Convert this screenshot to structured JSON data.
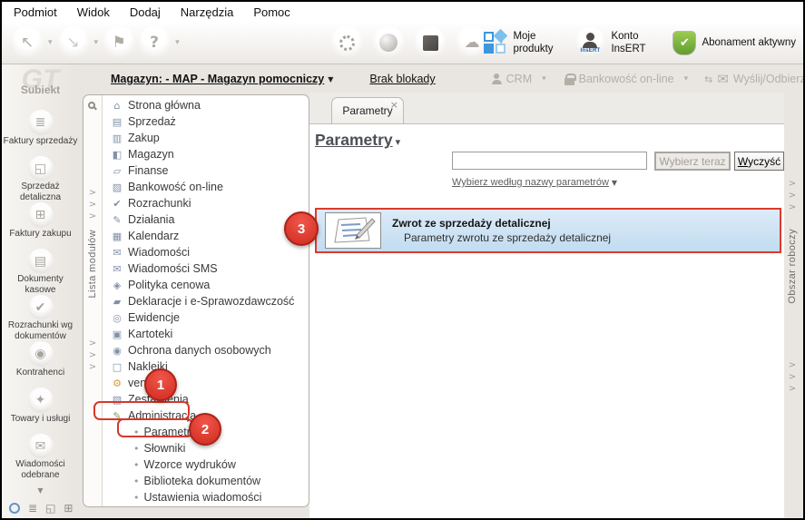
{
  "menubar": {
    "items": [
      {
        "label": "Podmiot"
      },
      {
        "label": "Widok"
      },
      {
        "label": "Dodaj"
      },
      {
        "label": "Narzędzia"
      },
      {
        "label": "Pomoc"
      }
    ]
  },
  "toolbar": {
    "moje_produkty_label": "Moje produkty",
    "konto_label": "Konto InsERT",
    "insert_badge": "InsERT",
    "abonament_label": "Abonament aktywny"
  },
  "subbar": {
    "magazyn_label": "Magazyn: - MAP - Magazyn pomocniczy",
    "brak_blokady_label": "Brak blokady",
    "crm_label": "CRM",
    "bankowosc_label": "Bankowość on-line",
    "wyslij_label": "Wyślij/Odbierz"
  },
  "sidebar": {
    "logo_text": "GT",
    "app_name": "Subiekt",
    "items": [
      {
        "label": "Faktury sprzedaży",
        "icon": "sales-invoices"
      },
      {
        "label": "Sprzedaż detaliczna",
        "icon": "retail-sales"
      },
      {
        "label": "Faktury zakupu",
        "icon": "purchase-invoices"
      },
      {
        "label": "Dokumenty kasowe",
        "icon": "cash-documents"
      },
      {
        "label": "Rozrachunki wg dokumentów",
        "icon": "settlements-by-documents"
      },
      {
        "label": "Kontrahenci",
        "icon": "contractors"
      },
      {
        "label": "Towary i usługi",
        "icon": "goods-services"
      },
      {
        "label": "Wiadomości odebrane",
        "icon": "inbox-messages"
      }
    ]
  },
  "module_panel": {
    "strip_label": "Lista modułów",
    "items": [
      {
        "label": "Strona główna",
        "icon": "home"
      },
      {
        "label": "Sprzedaż",
        "icon": "sales"
      },
      {
        "label": "Zakup",
        "icon": "purchase"
      },
      {
        "label": "Magazyn",
        "icon": "warehouse"
      },
      {
        "label": "Finanse",
        "icon": "finance"
      },
      {
        "label": "Bankowość on-line",
        "icon": "banking-online"
      },
      {
        "label": "Rozrachunki",
        "icon": "settlements"
      },
      {
        "label": "Działania",
        "icon": "actions"
      },
      {
        "label": "Kalendarz",
        "icon": "calendar"
      },
      {
        "label": "Wiadomości",
        "icon": "messages"
      },
      {
        "label": "Wiadomości SMS",
        "icon": "sms"
      },
      {
        "label": "Polityka cenowa",
        "icon": "pricing"
      },
      {
        "label": "Deklaracje i e-Sprawozdawczość",
        "icon": "declarations"
      },
      {
        "label": "Ewidencje",
        "icon": "records"
      },
      {
        "label": "Kartoteki",
        "icon": "card-files"
      },
      {
        "label": "Ochrona danych osobowych",
        "icon": "data-protection"
      },
      {
        "label": "Naklejki",
        "icon": "labels"
      },
      {
        "label": "vendero",
        "icon": "vendero"
      },
      {
        "label": "Zestawienia",
        "icon": "reports"
      },
      {
        "label": "Administracja",
        "icon": "administration"
      }
    ],
    "admin_children": [
      {
        "label": "Parametry"
      },
      {
        "label": "Słowniki"
      },
      {
        "label": "Wzorce wydruków"
      },
      {
        "label": "Biblioteka dokumentów"
      },
      {
        "label": "Ustawienia wiadomości"
      }
    ]
  },
  "main": {
    "tab_label": "Parametry",
    "page_title": "Parametry",
    "search_value": "",
    "select_button": "Wybierz teraz",
    "clear_button": "Wyczyść",
    "filter_link": "Wybierz według nazwy parametrów",
    "result": {
      "title": "Zwrot ze sprzedaży detalicznej",
      "subtitle": "Parametry zwrotu ze sprzedaży detalicznej"
    }
  },
  "right_strip": {
    "label": "Obszar roboczy"
  },
  "annotations": {
    "step1": "1",
    "step2": "2",
    "step3": "3"
  },
  "glyphs": {
    "caret_down": "▾",
    "caret_down_dark": "▼",
    "close": "×",
    "bullet": "•",
    "chevron": ">",
    "arrow_down": "▼",
    "arrow_back": "↖",
    "arrow_forward": "↘",
    "flag": "⚑",
    "help": "?",
    "cloud": "☁",
    "envelope": "✉",
    "transfer": "⇆",
    "check": "✔"
  },
  "colors": {
    "annotation_red": "#d8372c",
    "highlight_blue": "#c2dcf0",
    "accent_blue": "#3d97dd",
    "shield_green": "#5f9e31"
  }
}
